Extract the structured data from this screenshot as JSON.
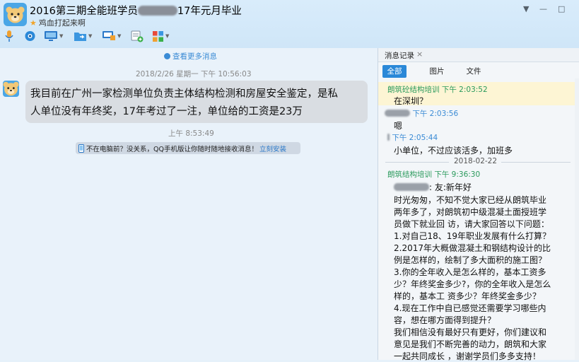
{
  "window": {
    "title_prefix": "2016第三期全能班学员",
    "title_suffix": "17年元月毕业",
    "signature": "鸡血打起来啊",
    "controls": {
      "menu": "▼",
      "minimize": "—",
      "maximize": "□"
    }
  },
  "toolbar": {
    "items": [
      {
        "icon": "microphone-icon",
        "has_menu": false
      },
      {
        "icon": "video-camera-icon",
        "has_menu": false
      },
      {
        "icon": "screen-share-icon",
        "has_menu": true
      },
      {
        "icon": "file-transfer-icon",
        "has_menu": true
      },
      {
        "icon": "remote-desktop-icon",
        "has_menu": true
      },
      {
        "icon": "create-group-icon",
        "has_menu": false
      },
      {
        "icon": "apps-grid-icon",
        "has_menu": true
      }
    ]
  },
  "chat": {
    "load_more": "查看更多消息",
    "timestamp1": "2018/2/26 星期一 下午 10:56:03",
    "message_lines": [
      "我目前在广州一家检测单位负责主体结构检测和房屋安全鉴定，是私",
      "人单位没有年终奖，17年考过了一注，单位给的工资是23万"
    ],
    "timestamp2": "上午 8:53:49",
    "notice_text": "不在电脑前？没关系，QQ手机版让你随时随地接收消息！",
    "notice_link": "立刻安装"
  },
  "history": {
    "title": "消息记录",
    "close": "×",
    "tabs": [
      "全部",
      "图片",
      "文件"
    ],
    "active_tab": "全部",
    "messages": [
      {
        "sender": "朗筑砼结构培训",
        "time": "下午 2:03:52",
        "lines": [
          "在深圳？"
        ]
      },
      {
        "sender": "",
        "time": "下午 2:03:56",
        "lines": [
          "嗯"
        ]
      },
      {
        "sender": "",
        "time": "下午 2:05:44",
        "lines": [
          "小单位，不过应该活多，加班多"
        ]
      },
      {
        "sender": "朗筑结构培训",
        "time": "下午 9:36:30",
        "lines": [
          ": 友:新年好",
          "时光匆匆，不知不觉大家已经从朗筑毕业",
          "两年多了，对朗筑初中级混凝土面授班学",
          "员做下就业回 访，请大家回答以下问题：",
          "1.对自己18、19年职业发展有什么打算？",
          "2.2017年大概做混凝土和钢结构设计的比",
          "例是怎样的，绘制了多大面积的施工图？",
          "3.你的全年收入是怎么样的，基本工资多",
          "少？年终奖金多少?，你的全年收入是怎么",
          "样的，基本工 资多少？年终奖金多少？",
          "4.现在工作中自已感觉还需要学习哪些内",
          "容，想在哪方面得到提升？",
          "我们相信没有最好只有更好，你们建议和",
          "意见是我们不断完善的动力，朗筑和大家",
          "一起共同成长 ，谢谢学员们多多支持！"
        ]
      }
    ],
    "date_separator": "2018-02-22"
  },
  "colors": {
    "accent": "#2a88d8",
    "sender_green": "#2a9a5c",
    "highlight": "#fdf5d4"
  }
}
